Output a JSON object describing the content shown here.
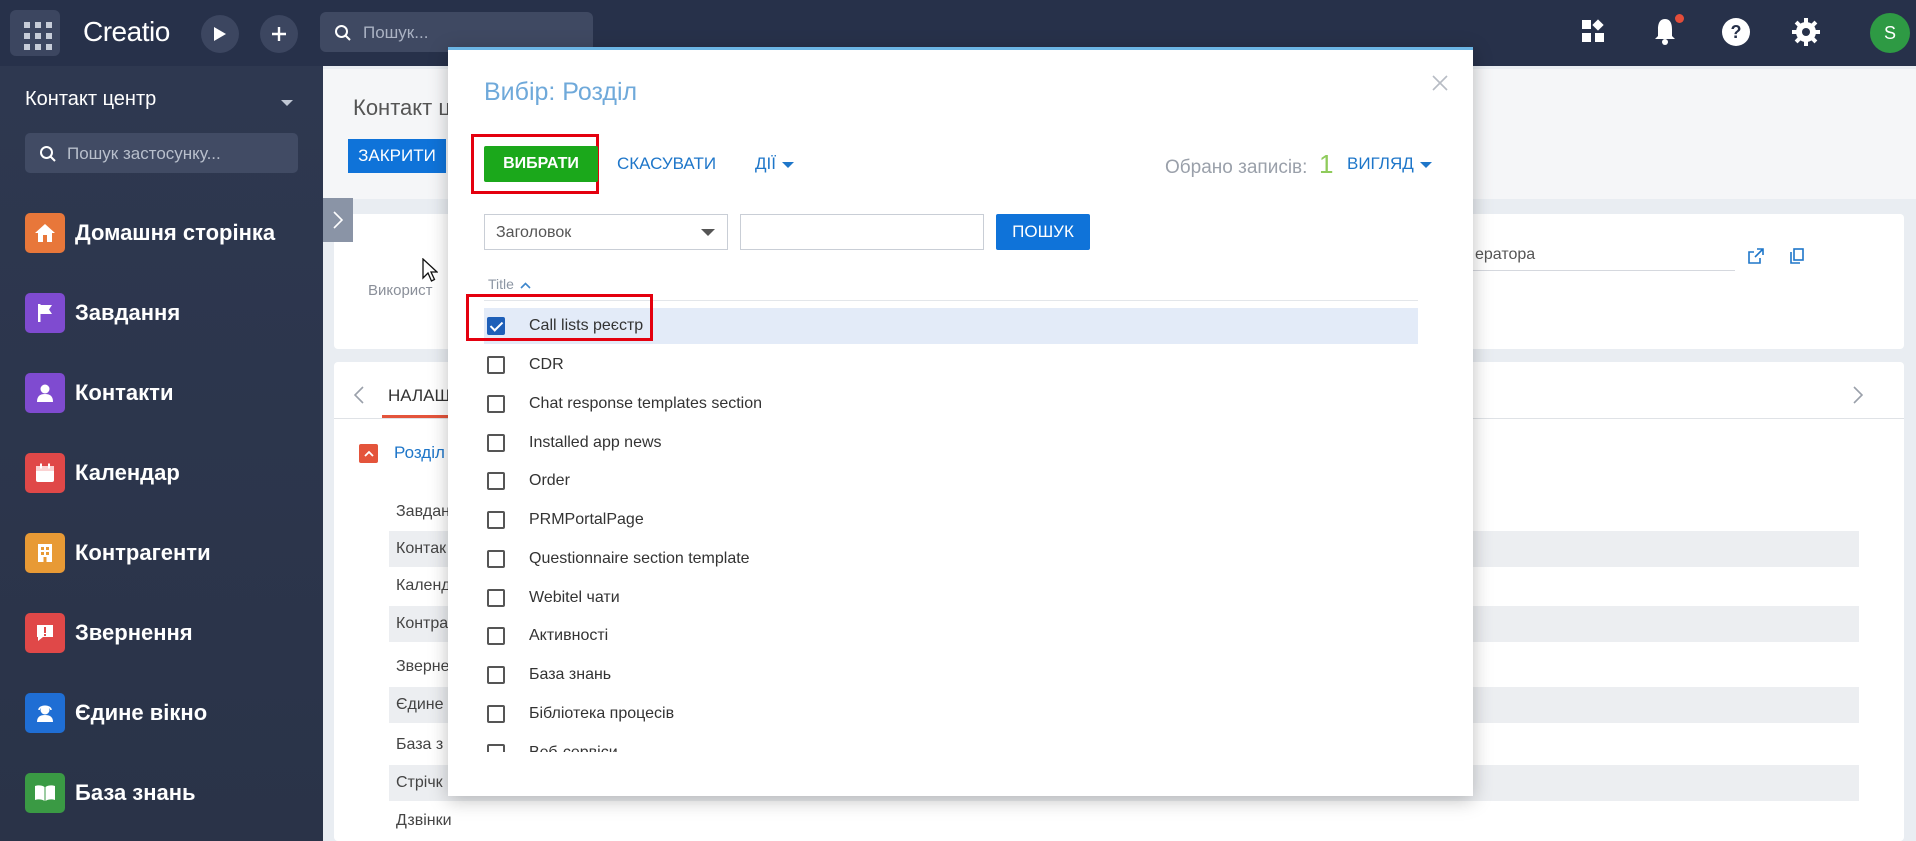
{
  "topbar": {
    "logo": "Creatio",
    "search_placeholder": "Пошук...",
    "user_initial": "S"
  },
  "sidebar": {
    "workspace": "Контакт центр",
    "search_placeholder": "Пошук застосунку...",
    "items": [
      {
        "label": "Домашня сторінка",
        "color": "#e8773a",
        "icon": "home-icon"
      },
      {
        "label": "Завдання",
        "color": "#7f4bd0",
        "icon": "flag-icon"
      },
      {
        "label": "Контакти",
        "color": "#7f4bd0",
        "icon": "person-icon"
      },
      {
        "label": "Календар",
        "color": "#e04848",
        "icon": "calendar-icon"
      },
      {
        "label": "Контрагенти",
        "color": "#e89a35",
        "icon": "building-icon"
      },
      {
        "label": "Звернення",
        "color": "#e04848",
        "icon": "alert-icon"
      },
      {
        "label": "Єдине вікно",
        "color": "#1f6ed4",
        "icon": "agent-icon"
      },
      {
        "label": "База знань",
        "color": "#3a9a44",
        "icon": "book-icon"
      }
    ]
  },
  "background_page": {
    "title": "Контакт ц",
    "close_button": "ЗАКРИТИ",
    "user_label": "Використ",
    "operator_text": "ератора",
    "tab": "НАЛАШ",
    "group": "Розділ",
    "rows": [
      "Завдан",
      "Контак",
      "Календ",
      "Контра",
      "Зверне",
      "Єдине",
      "База з",
      "Стрічк",
      "Дзвінки"
    ]
  },
  "modal": {
    "title": "Вибір: Розділ",
    "select_button": "ВИБРАТИ",
    "cancel_button": "СКАСУВАТИ",
    "actions_button": "ДІЇ",
    "selected_label": "Обрано записів:",
    "selected_count": "1",
    "view_button": "ВИГЛЯД",
    "filter_column": "Заголовок",
    "filter_value": "",
    "search_button": "ПОШУК",
    "column_header": "Title",
    "rows": [
      {
        "title": "Call lists реєстр",
        "checked": true
      },
      {
        "title": "CDR",
        "checked": false
      },
      {
        "title": "Chat response templates section",
        "checked": false
      },
      {
        "title": "Installed app news",
        "checked": false
      },
      {
        "title": "Order",
        "checked": false
      },
      {
        "title": "PRMPortalPage",
        "checked": false
      },
      {
        "title": "Questionnaire section template",
        "checked": false
      },
      {
        "title": "Webitel чати",
        "checked": false
      },
      {
        "title": "Активності",
        "checked": false
      },
      {
        "title": "База знань",
        "checked": false
      },
      {
        "title": "Бібліотека процесів",
        "checked": false
      },
      {
        "title": "Веб-сервіси",
        "checked": false
      }
    ]
  }
}
